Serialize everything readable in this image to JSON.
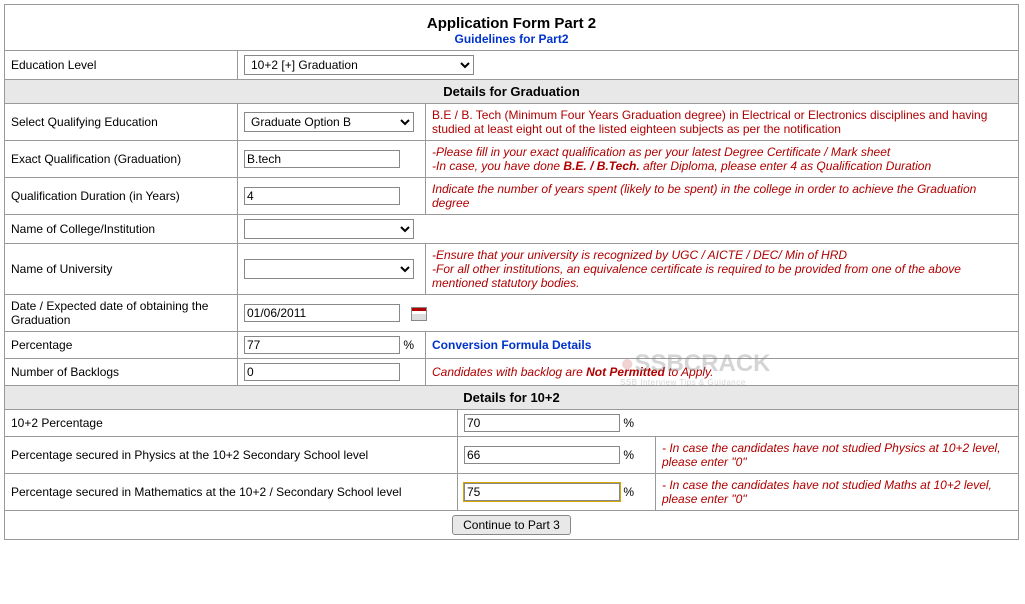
{
  "header": {
    "title": "Application Form Part 2",
    "guidelines_link": "Guidelines for Part2"
  },
  "education_level": {
    "label": "Education Level",
    "value": "10+2 [+] Graduation"
  },
  "graduation": {
    "section_title": "Details for Graduation",
    "qualifying": {
      "label": "Select Qualifying Education",
      "value": "Graduate Option B",
      "hint": "B.E / B. Tech (Minimum Four Years Graduation degree) in Electrical or Electronics disciplines and having studied at least eight out of the listed eighteen subjects as per the notification"
    },
    "exact_qual": {
      "label": "Exact Qualification (Graduation)",
      "value": "B.tech",
      "hint_pre": "-Please fill in your exact qualification as per your latest Degree Certificate / Mark sheet",
      "hint_line2a": "-In case, you have done ",
      "hint_line2b": "B.E. / B.Tech.",
      "hint_line2c": " after Diploma, please enter 4 as Qualification Duration"
    },
    "duration": {
      "label": "Qualification Duration (in Years)",
      "value": "4",
      "hint": "Indicate the number of years spent (likely to be spent) in the college in order to achieve the Graduation degree"
    },
    "college": {
      "label": "Name of College/Institution",
      "value": ""
    },
    "university": {
      "label": "Name of University",
      "value": "",
      "hint1": "-Ensure that your university is recognized by UGC / AICTE / DEC/ Min of HRD",
      "hint2": "-For all other institutions, an equivalence certificate is required to be provided from one of the above mentioned statutory bodies."
    },
    "grad_date": {
      "label": "Date / Expected date of obtaining the Graduation",
      "value": "01/06/2011"
    },
    "percentage": {
      "label": "Percentage",
      "value": "77",
      "suffix": "%",
      "link": "Conversion Formula Details"
    },
    "backlogs": {
      "label": "Number of Backlogs",
      "value": "0",
      "hint_a": "Candidates with backlog are ",
      "hint_b": "Not Permitted",
      "hint_c": " to Apply."
    }
  },
  "tenplus2": {
    "section_title": "Details for 10+2",
    "percentage": {
      "label": "10+2 Percentage",
      "value": "70",
      "suffix": "%"
    },
    "physics": {
      "label": "Percentage secured in Physics at the 10+2 Secondary School level",
      "value": "66",
      "suffix": "%",
      "hint": "- In case the candidates have not studied Physics at 10+2 level, please enter \"0\""
    },
    "maths": {
      "label": "Percentage secured in Mathematics at the 10+2 / Secondary School level",
      "value": "75",
      "suffix": "%",
      "hint": "- In case the candidates have not studied Maths at 10+2 level, please enter \"0\""
    }
  },
  "continue_btn": "Continue to Part 3",
  "watermark": {
    "main": "SSBCRACK",
    "sub": "SSB Interview Tips & Guidance"
  }
}
